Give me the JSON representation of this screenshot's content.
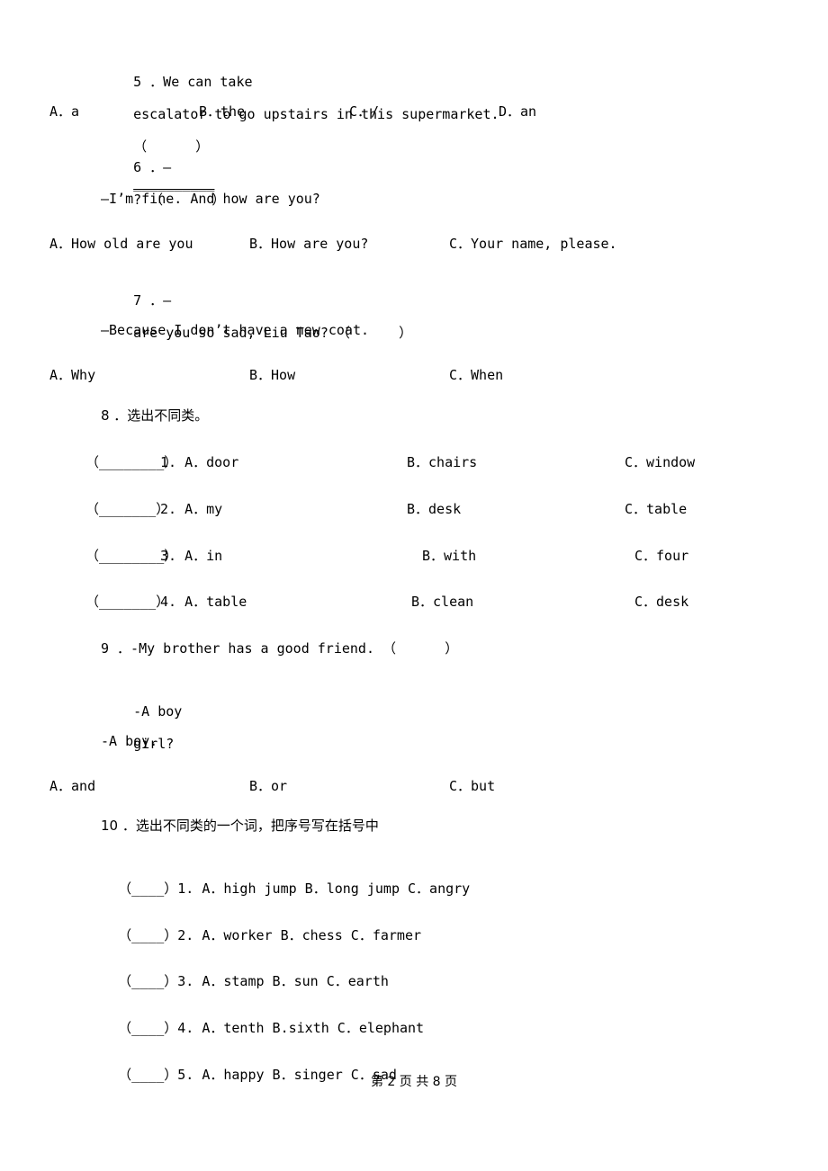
{
  "document": {
    "footer": {
      "prefix": "第",
      "page": "2",
      "middle": "页 共",
      "total": "8",
      "suffix": "页"
    }
  },
  "questions": [
    {
      "id": "q5",
      "stem_a": "5 ．We can take",
      "stem_b": "escalator to go upstairs in this supermarket.",
      "marker": "（      ）",
      "options": [
        "A．a",
        "B．the",
        "C．/",
        "D．an"
      ]
    },
    {
      "id": "q6",
      "stem_a": "6 ．—",
      "stem_blank": "__________",
      "stem_b": "? （      ）",
      "answer_line": "—I’m fine. And how are you?",
      "options": [
        "A．How old are you",
        "B．How are you?",
        "C．Your name, please."
      ]
    },
    {
      "id": "q7",
      "stem_a": "7 ．—",
      "stem_b": "are you so sad, Liu Tao? （      ）",
      "answer_line": "—Because I don’t have a new coat.",
      "options": [
        "A．Why",
        "B．How",
        "C．When"
      ]
    },
    {
      "id": "q8",
      "stem": "8 ．选出不同类。",
      "items": [
        {
          "blank": "（________）",
          "a": "1. A．door",
          "b": "B．chairs",
          "c": "C．window"
        },
        {
          "blank": "（_______）",
          "a": "2. A．my",
          "b": "B．desk",
          "c": "C．table"
        },
        {
          "blank": "（________）",
          "a": "3. A．in",
          "b": "B．with",
          "c": "C．four"
        },
        {
          "blank": "（_______）",
          "a": "4. A．table",
          "b": "B．clean",
          "c": "C．desk"
        }
      ]
    },
    {
      "id": "q9",
      "stem": "9 ．-My brother has a good friend. （      ）",
      "line2_a": "-A boy",
      "line2_b": "girl?",
      "line3": "-A boy.",
      "options": [
        "A．and",
        "B．or",
        "C．but"
      ]
    },
    {
      "id": "q10",
      "stem": "10 ．选出不同类的一个词，把序号写在括号中",
      "items": [
        {
          "blank": "（____）",
          "text": "1. A．high jump B．long jump C．angry"
        },
        {
          "blank": "（____）",
          "text": "2. A．worker B．chess C．farmer"
        },
        {
          "blank": "（____）",
          "text": "3. A．stamp B．sun C．earth"
        },
        {
          "blank": "（____）",
          "text": "4. A．tenth B.sixth C．elephant"
        },
        {
          "blank": "（____）",
          "text": "5. A．happy B．singer C．sad"
        }
      ]
    }
  ]
}
